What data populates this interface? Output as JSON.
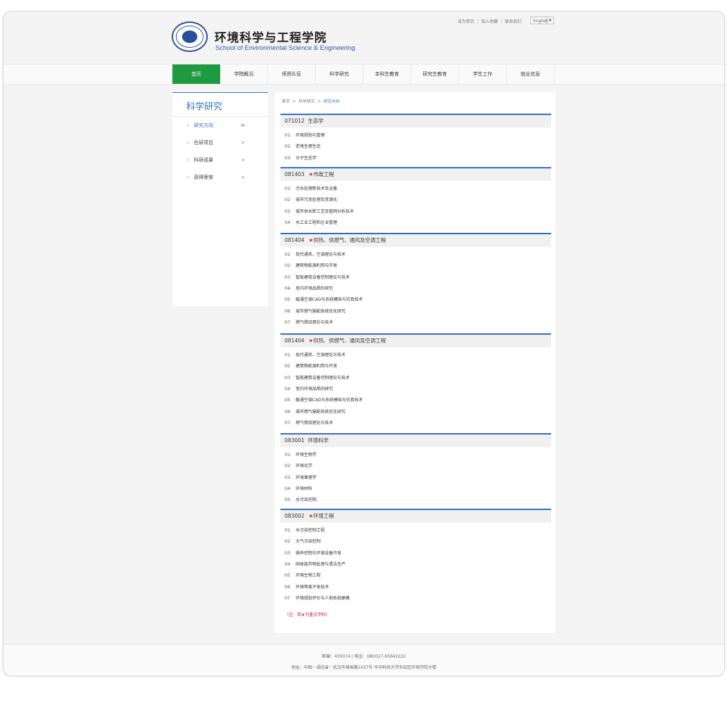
{
  "header": {
    "title": "环境科学与工程学院",
    "subtitle": "School of Environmental Science & Engineering",
    "toplinks": [
      "设为首页",
      "加入收藏",
      "联系我们"
    ],
    "language": "English"
  },
  "nav": {
    "items": [
      "首页",
      "学院概况",
      "师资队伍",
      "科学研究",
      "本科生教育",
      "研究生教育",
      "学生工作",
      "就业信息"
    ],
    "active_index": 0
  },
  "sidebar": {
    "title": "科学研究",
    "items": [
      {
        "label": "研究方向",
        "active": true
      },
      {
        "label": "在研项目",
        "active": false
      },
      {
        "label": "科研成果",
        "active": false
      },
      {
        "label": "获得荣誉",
        "active": false
      }
    ]
  },
  "breadcrumb": {
    "items": [
      "首页",
      "科学研究",
      "研究方向"
    ]
  },
  "sections": [
    {
      "code": "071012",
      "star": false,
      "name": "生态学",
      "items": [
        {
          "num": "01",
          "text": "环境规划与管理"
        },
        {
          "num": "02",
          "text": "逆境生理生态"
        },
        {
          "num": "03",
          "text": "分子生态学"
        }
      ]
    },
    {
      "code": "081403",
      "star": true,
      "name": "市政工程",
      "items": [
        {
          "num": "01",
          "text": "污水处理新技术及设备"
        },
        {
          "num": "02",
          "text": "城市污泥处理及资源化"
        },
        {
          "num": "03",
          "text": "城市供水新工艺及管网分析技术"
        },
        {
          "num": "04",
          "text": "水工业工程和企业管理"
        }
      ]
    },
    {
      "code": "081404",
      "star": true,
      "name": "供热、供燃气、通风及空调工程",
      "items": [
        {
          "num": "01",
          "text": "现代通风、空调理论与技术"
        },
        {
          "num": "02",
          "text": "建筑物能源利用与开发"
        },
        {
          "num": "03",
          "text": "智能建筑设备控制理论与技术"
        },
        {
          "num": "04",
          "text": "室内环境品质的研究"
        },
        {
          "num": "05",
          "text": "暖通空调CAD与系统模拟与仿真技术"
        },
        {
          "num": "06",
          "text": "城市燃气输配系统优化研究"
        },
        {
          "num": "07",
          "text": "燃气燃烧理论与技术"
        }
      ]
    },
    {
      "code": "081404",
      "star": true,
      "name": "供热、供燃气、通风及空调工程",
      "items": [
        {
          "num": "01",
          "text": "现代通风、空调理论与技术"
        },
        {
          "num": "02",
          "text": "建筑物能源利用与开发"
        },
        {
          "num": "03",
          "text": "智能建筑设备控制理论与技术"
        },
        {
          "num": "04",
          "text": "室内环境品质的研究"
        },
        {
          "num": "05",
          "text": "暖通空调CAD与系统模拟与仿真技术"
        },
        {
          "num": "06",
          "text": "城市燃气输配系统优化研究"
        },
        {
          "num": "07",
          "text": "燃气燃烧理论与技术"
        }
      ]
    },
    {
      "code": "083001",
      "star": false,
      "name": "环境科学",
      "items": [
        {
          "num": "01",
          "text": "环境生物学"
        },
        {
          "num": "02",
          "text": "环境化学"
        },
        {
          "num": "03",
          "text": "环境毒理学"
        },
        {
          "num": "04",
          "text": "环境材料"
        },
        {
          "num": "05",
          "text": "水污染控制"
        }
      ]
    },
    {
      "code": "083002",
      "star": true,
      "name": "环境工程",
      "items": [
        {
          "num": "01",
          "text": "水污染控制工程"
        },
        {
          "num": "02",
          "text": "大气污染控制"
        },
        {
          "num": "03",
          "text": "噪声控制与环保设备开发"
        },
        {
          "num": "04",
          "text": "固体废弃物处理与清洁生产"
        },
        {
          "num": "05",
          "text": "环境生物工程"
        },
        {
          "num": "06",
          "text": "环境等离子体技术"
        },
        {
          "num": "07",
          "text": "环境规划评价与人地系统建模"
        }
      ]
    }
  ],
  "note": "（注：带★为重点学科）",
  "star_symbol": "★",
  "footer": {
    "line1": "邮编：430074 | 电话：(86)027-65642222",
    "line2": "地址：中国・湖北省・武汉市珞喻路1037号 华中科技大学东校区环境学院大楼"
  },
  "colors": {
    "accent": "#2f6fc0",
    "nav_active": "#1e9a40",
    "star": "#d03030",
    "note": "#c02030"
  }
}
